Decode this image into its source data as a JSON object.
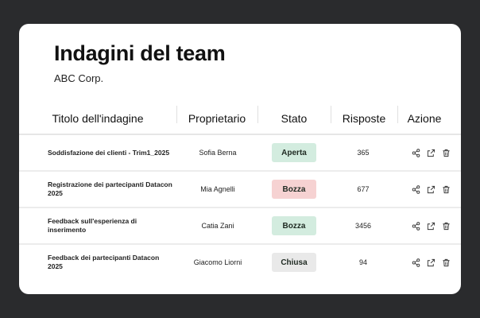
{
  "header": {
    "title": "Indagini del team",
    "subtitle": "ABC Corp."
  },
  "table": {
    "columns": [
      "Titolo dell'indagine",
      "Proprietario",
      "Stato",
      "Risposte",
      "Azione"
    ],
    "rows": [
      {
        "title": "Soddisfazione dei clienti - Trim1_2025",
        "owner": "Sofia Berna",
        "status": "Aperta",
        "responses": "365"
      },
      {
        "title": "Registrazione dei partecipanti Datacon 2025",
        "owner": "Mia Agnelli",
        "status": "Bozza",
        "responses": "677"
      },
      {
        "title": "Feedback sull'esperienza di inserimento",
        "owner": "Catia Zani",
        "status": "Bozza",
        "responses": "3456"
      },
      {
        "title": "Feedback dei partecipanti Datacon 2025",
        "owner": "Giacomo Liorni",
        "status": "Chiusa",
        "responses": "94"
      }
    ],
    "actions": [
      "share-icon",
      "export-icon",
      "delete-icon"
    ]
  },
  "colors": {
    "frame": "#2a2b2d",
    "status_aperta": "#d3ecdf",
    "status_bozza_row2": "#f6d2d2",
    "status_bozza_row3": "#d3ecdf",
    "status_chiusa": "#e9e9e9"
  }
}
